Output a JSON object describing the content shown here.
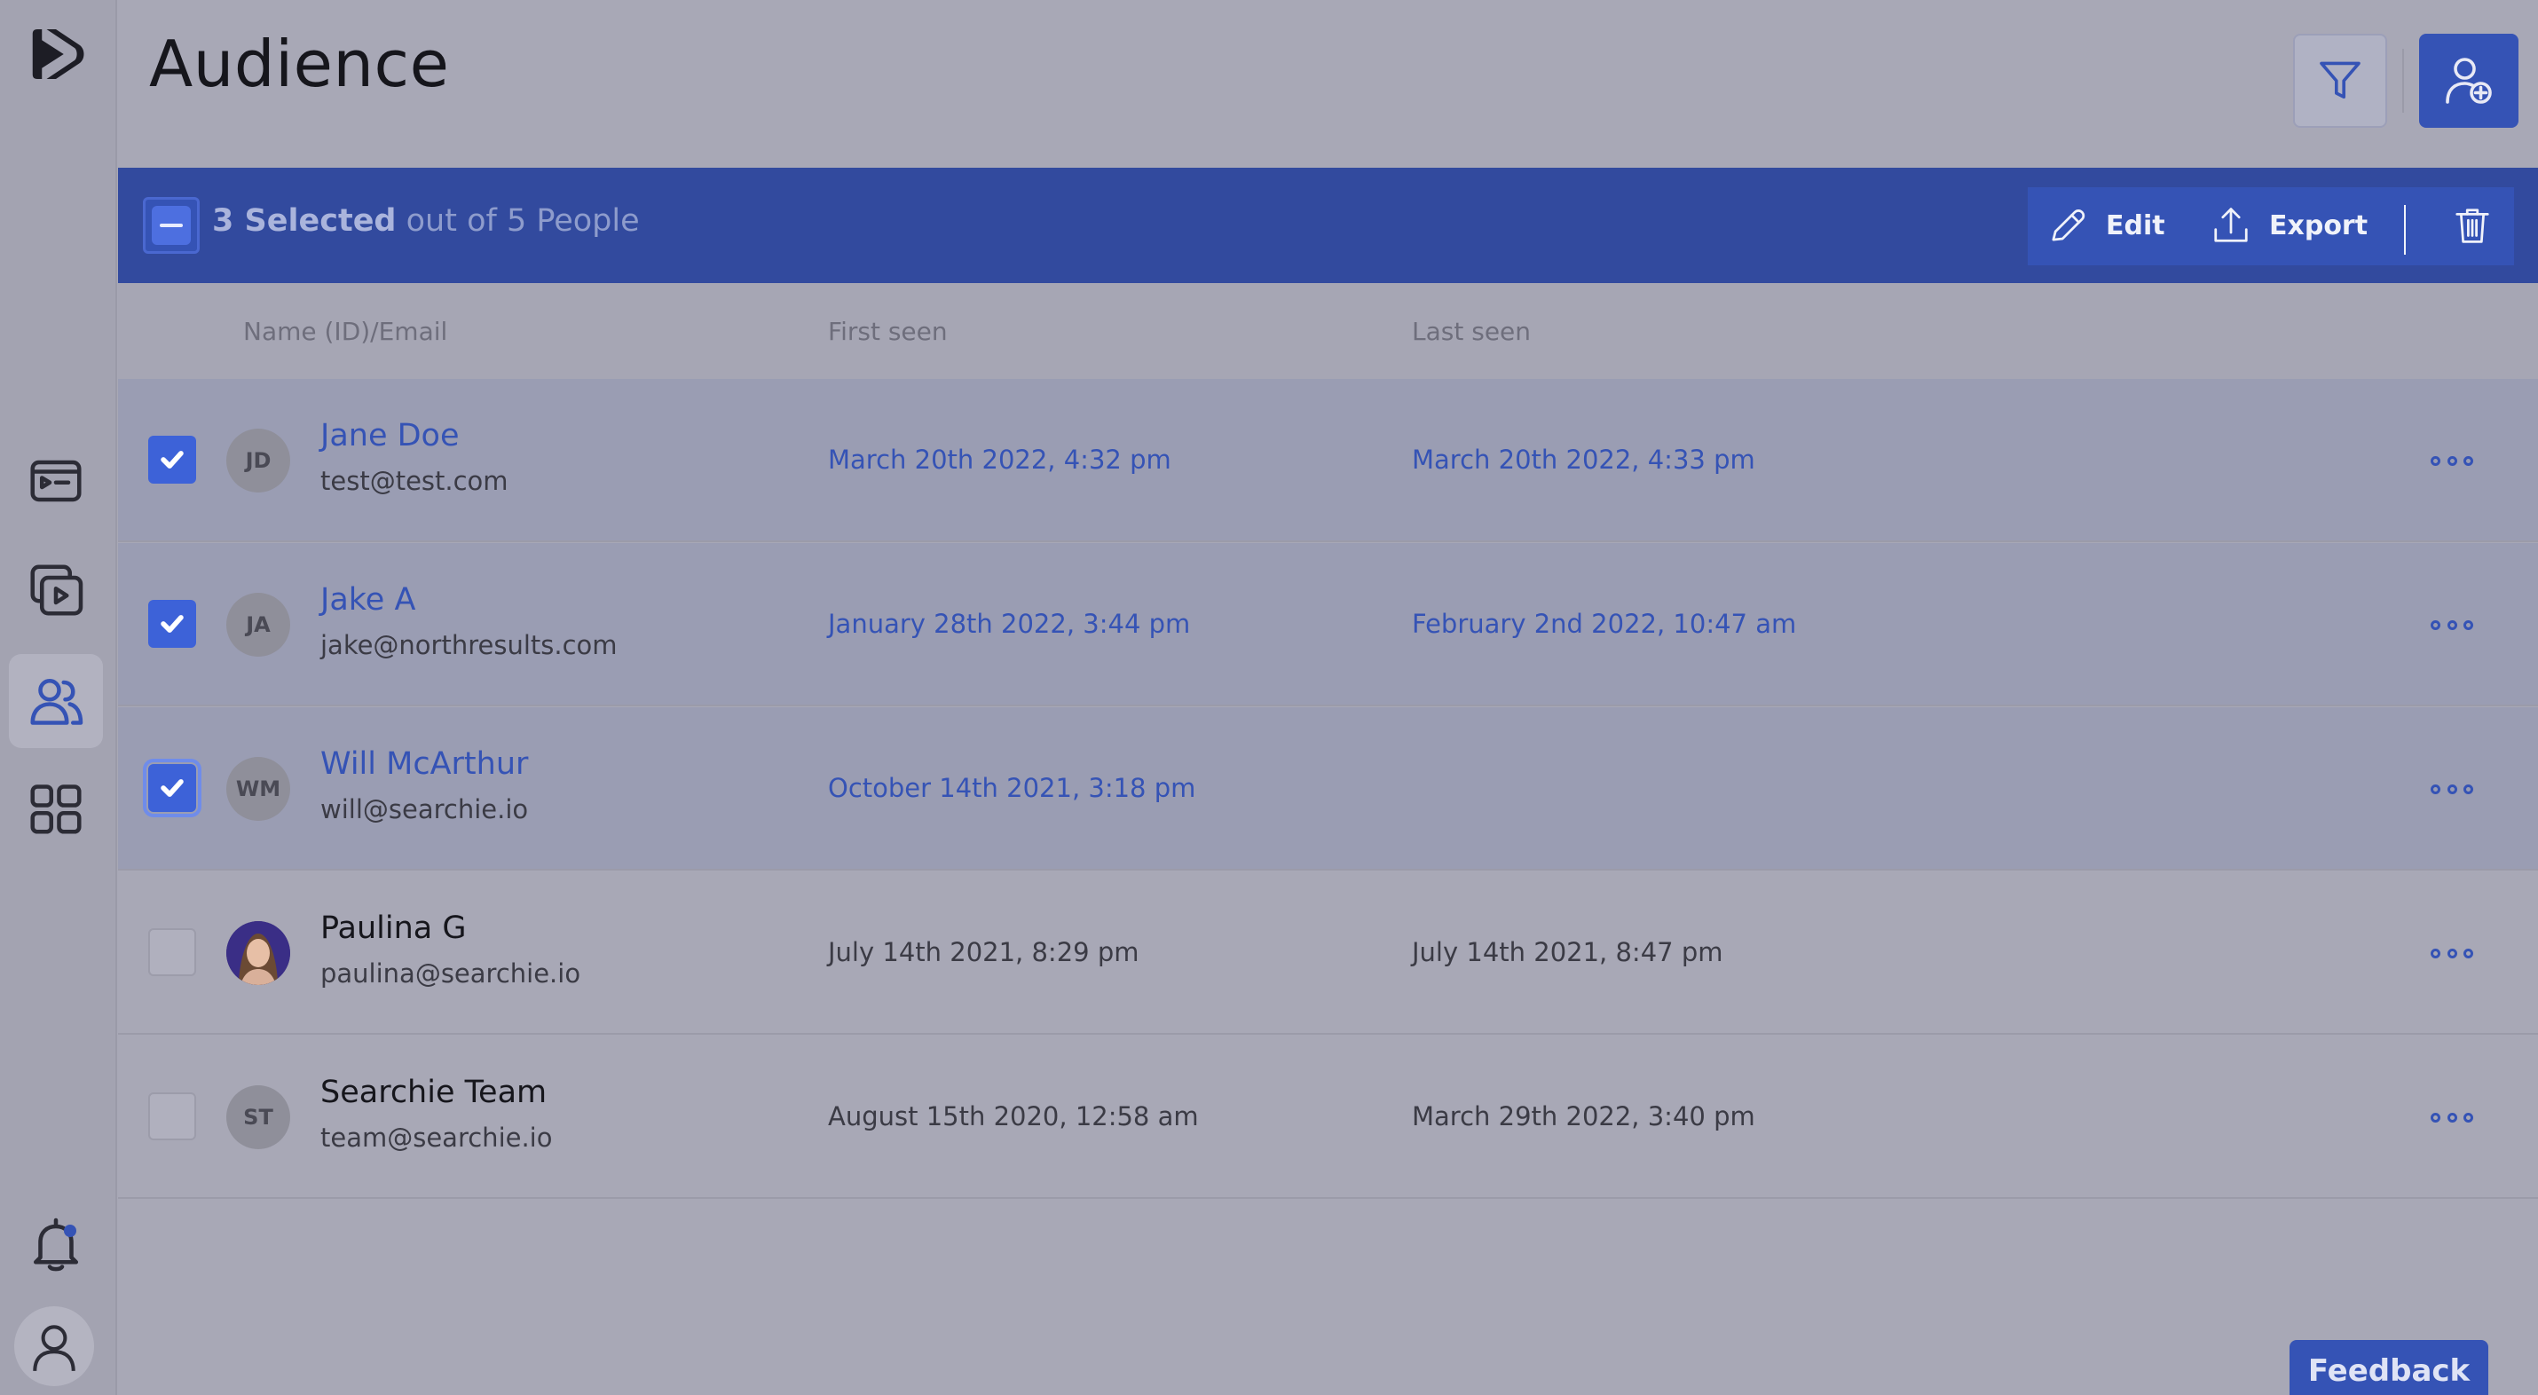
{
  "header": {
    "title": "Audience"
  },
  "selection": {
    "count_label": "3 Selected",
    "suffix": "out of 5 People"
  },
  "actions": {
    "edit_label": "Edit",
    "export_label": "Export"
  },
  "columns": {
    "name": "Name (ID)/Email",
    "first_seen": "First seen",
    "last_seen": "Last seen"
  },
  "rows": [
    {
      "initials": "JD",
      "name": "Jane Doe",
      "email": "test@test.com",
      "first_seen": "March 20th 2022, 4:32 pm",
      "last_seen": "March 20th 2022, 4:33 pm",
      "selected": true
    },
    {
      "initials": "JA",
      "name": "Jake A",
      "email": "jake@northresults.com",
      "first_seen": "January 28th 2022, 3:44 pm",
      "last_seen": "February 2nd 2022, 10:47 am",
      "selected": true
    },
    {
      "initials": "WM",
      "name": "Will McArthur",
      "email": "will@searchie.io",
      "first_seen": "October 14th 2021, 3:18 pm",
      "last_seen": "",
      "selected": true
    },
    {
      "initials": "",
      "name": "Paulina G",
      "email": "paulina@searchie.io",
      "first_seen": "July 14th 2021, 8:29 pm",
      "last_seen": "July 14th 2021, 8:47 pm",
      "selected": false
    },
    {
      "initials": "ST",
      "name": "Searchie Team",
      "email": "team@searchie.io",
      "first_seen": "August 15th 2020, 12:58 am",
      "last_seen": "March 29th 2022, 3:40 pm",
      "selected": false
    }
  ],
  "feedback": {
    "label": "Feedback"
  },
  "colors": {
    "accent": "#3553b5",
    "selection_bar": "#324a9e",
    "checkbox": "#3d62d8"
  }
}
